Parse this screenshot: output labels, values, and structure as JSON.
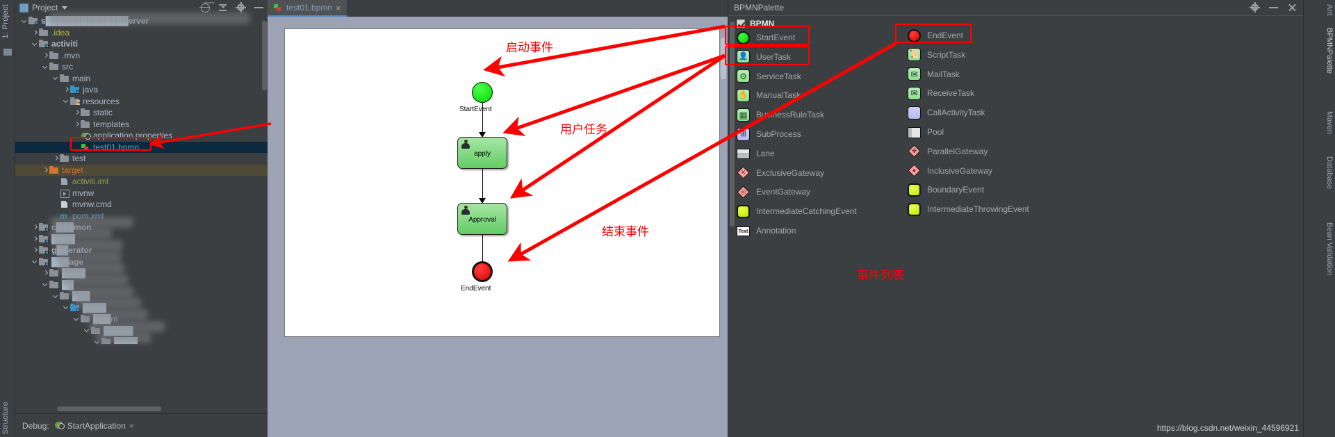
{
  "window": {
    "left_strip": {
      "project_label": "1: Project",
      "structure_label": "Structure"
    },
    "right_strip": {
      "tabs": [
        "Ant",
        "BPMNPalette",
        "Maven",
        "Database",
        "Bean Validation"
      ]
    },
    "watermark": "https://blog.csdn.net/weixin_44596921"
  },
  "project_panel": {
    "title": "Project",
    "actions": [
      "target-icon",
      "collapse-all-icon",
      "settings-icon",
      "hide-icon"
    ],
    "tree": [
      {
        "indent": 0,
        "arrow": "down",
        "icon": "module-folder",
        "label": "s██████████████erver",
        "color": "gray",
        "bold": true,
        "blurred": true
      },
      {
        "indent": 1,
        "arrow": "right",
        "icon": "folder",
        "label": ".idea",
        "color": "yellow"
      },
      {
        "indent": 1,
        "arrow": "down",
        "icon": "module-folder",
        "label": "activiti",
        "color": "gray",
        "bold": true
      },
      {
        "indent": 2,
        "arrow": "right",
        "icon": "folder",
        "label": ".mvn",
        "color": "gray"
      },
      {
        "indent": 2,
        "arrow": "down",
        "icon": "folder",
        "label": "src",
        "color": "gray"
      },
      {
        "indent": 3,
        "arrow": "down",
        "icon": "folder",
        "label": "main",
        "color": "gray"
      },
      {
        "indent": 4,
        "arrow": "right",
        "icon": "java-folder",
        "label": "java",
        "color": "gray"
      },
      {
        "indent": 4,
        "arrow": "down",
        "icon": "resources-folder",
        "label": "resources",
        "color": "gray"
      },
      {
        "indent": 5,
        "arrow": "right",
        "icon": "folder",
        "label": "static",
        "color": "gray"
      },
      {
        "indent": 5,
        "arrow": "right",
        "icon": "folder",
        "label": "templates",
        "color": "gray"
      },
      {
        "indent": 5,
        "arrow": "none",
        "icon": "properties-file",
        "label": "application.properties",
        "color": "gray"
      },
      {
        "indent": 5,
        "arrow": "none",
        "icon": "bpmn-file",
        "label": "test01.bpmn",
        "color": "blue",
        "selected": true
      },
      {
        "indent": 3,
        "arrow": "right",
        "icon": "folder",
        "label": "test",
        "color": "gray"
      },
      {
        "indent": 2,
        "arrow": "right",
        "icon": "orange-folder",
        "label": "target",
        "color": "orange",
        "highlight": "target"
      },
      {
        "indent": 3,
        "arrow": "none",
        "icon": "iml-file",
        "label": "activiti.iml",
        "color": "olive"
      },
      {
        "indent": 3,
        "arrow": "none",
        "icon": "exe-file",
        "label": "mvnw",
        "color": "gray"
      },
      {
        "indent": 3,
        "arrow": "none",
        "icon": "text-file",
        "label": "mvnw.cmd",
        "color": "gray"
      },
      {
        "indent": 3,
        "arrow": "none",
        "icon": "maven-file",
        "label": "pom.xml",
        "color": "blue"
      },
      {
        "indent": 1,
        "arrow": "right",
        "icon": "module-folder",
        "label": "c███mon",
        "color": "gray",
        "bold": true,
        "blurred": true
      },
      {
        "indent": 1,
        "arrow": "right",
        "icon": "module-folder",
        "label": "████",
        "color": "gray",
        "bold": true,
        "blurred": true
      },
      {
        "indent": 1,
        "arrow": "right",
        "icon": "module-folder",
        "label": "g██erator",
        "color": "gray",
        "bold": true,
        "blurred": true
      },
      {
        "indent": 1,
        "arrow": "down",
        "icon": "module-folder",
        "label": "███age",
        "color": "gray",
        "bold": true,
        "blurred": true
      },
      {
        "indent": 2,
        "arrow": "right",
        "icon": "folder",
        "label": "████",
        "color": "gray",
        "blurred": true
      },
      {
        "indent": 2,
        "arrow": "down",
        "icon": "folder",
        "label": "██",
        "color": "gray",
        "blurred": true
      },
      {
        "indent": 3,
        "arrow": "down",
        "icon": "folder",
        "label": "███",
        "color": "gray",
        "blurred": true
      },
      {
        "indent": 4,
        "arrow": "down",
        "icon": "java-folder",
        "label": "████",
        "color": "gray",
        "blurred": true
      },
      {
        "indent": 5,
        "arrow": "down",
        "icon": "folder",
        "label": "███m",
        "color": "gray",
        "blurred": true
      },
      {
        "indent": 6,
        "arrow": "down",
        "icon": "folder",
        "label": "█████",
        "color": "gray",
        "blurred": true
      },
      {
        "indent": 7,
        "arrow": "down",
        "icon": "folder",
        "label": "████",
        "color": "gray",
        "blurred": true
      }
    ],
    "debug": {
      "label": "Debug:",
      "tab_name": "StartApplication",
      "close": "×"
    }
  },
  "editor": {
    "tab": {
      "label": "test01.bpmn",
      "close": "×",
      "icon": "bpmn-file-icon"
    },
    "diagram": {
      "nodes": [
        {
          "id": "start",
          "type": "startEvent",
          "label": "StartEvent"
        },
        {
          "id": "apply",
          "type": "userTask",
          "label": "apply"
        },
        {
          "id": "approval",
          "type": "userTask",
          "label": "Approval"
        },
        {
          "id": "end",
          "type": "endEvent",
          "label": "EndEvent"
        }
      ],
      "flows": [
        {
          "from": "start",
          "to": "apply"
        },
        {
          "from": "apply",
          "to": "approval"
        },
        {
          "from": "approval",
          "to": "end"
        }
      ]
    }
  },
  "annotations": {
    "start_event_cn": "启动事件",
    "user_task_cn": "用户任务",
    "end_event_cn": "结束事件",
    "event_list_cn": "事件列表",
    "highlight_color": "#ff0000"
  },
  "palette": {
    "title": "BPMNPalette",
    "actions": [
      "settings-icon",
      "hide-icon",
      "close-icon"
    ],
    "group": {
      "label": "BPMN",
      "checked": true
    },
    "items_left": [
      {
        "label": "StartEvent",
        "icon": "green-circle",
        "highlighted": true
      },
      {
        "label": "UserTask",
        "icon": "user-task",
        "highlighted": true
      },
      {
        "label": "ServiceTask",
        "icon": "service-task"
      },
      {
        "label": "ManualTask",
        "icon": "manual-task"
      },
      {
        "label": "BusinessRuleTask",
        "icon": "business-rule-task"
      },
      {
        "label": "SubProcess",
        "icon": "subprocess"
      },
      {
        "label": "Lane",
        "icon": "lane"
      },
      {
        "label": "ExclusiveGateway",
        "icon": "exclusive-gateway"
      },
      {
        "label": "EventGateway",
        "icon": "event-gateway"
      },
      {
        "label": "IntermediateCatchingEvent",
        "icon": "intermediate-catching-event"
      },
      {
        "label": "Annotation",
        "icon": "annotation"
      }
    ],
    "items_right": [
      {
        "label": "EndEvent",
        "icon": "red-circle",
        "highlighted": true
      },
      {
        "label": "ScriptTask",
        "icon": "script-task"
      },
      {
        "label": "MailTask",
        "icon": "mail-task"
      },
      {
        "label": "ReceiveTask",
        "icon": "receive-task"
      },
      {
        "label": "CallActivityTask",
        "icon": "call-activity-task"
      },
      {
        "label": "Pool",
        "icon": "pool"
      },
      {
        "label": "ParallelGateway",
        "icon": "parallel-gateway"
      },
      {
        "label": "InclusiveGateway",
        "icon": "inclusive-gateway"
      },
      {
        "label": "BoundaryEvent",
        "icon": "boundary-event"
      },
      {
        "label": "IntermediateThrowingEvent",
        "icon": "intermediate-throwing-event"
      }
    ]
  }
}
